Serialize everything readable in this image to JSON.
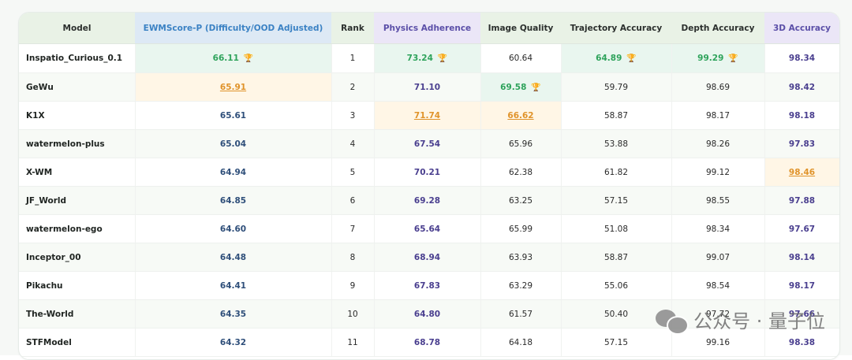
{
  "headers": {
    "model": "Model",
    "ewm": "EWMScore-P (Difficulty/OOD Adjusted)",
    "rank": "Rank",
    "phys": "Physics Adherence",
    "img": "Image Quality",
    "traj": "Trajectory Accuracy",
    "depth": "Depth Accuracy",
    "d3": "3D Accuracy"
  },
  "rows": [
    {
      "model": "Inspatio_Curious_0.1",
      "ewm": "66.11",
      "rank": "1",
      "phys": "73.24",
      "img": "60.64",
      "traj": "64.89",
      "depth": "99.29",
      "d3": "98.34"
    },
    {
      "model": "GeWu",
      "ewm": "65.91",
      "rank": "2",
      "phys": "71.10",
      "img": "69.58",
      "traj": "59.79",
      "depth": "98.69",
      "d3": "98.42"
    },
    {
      "model": "K1X",
      "ewm": "65.61",
      "rank": "3",
      "phys": "71.74",
      "img": "66.62",
      "traj": "58.87",
      "depth": "98.17",
      "d3": "98.18"
    },
    {
      "model": "watermelon-plus",
      "ewm": "65.04",
      "rank": "4",
      "phys": "67.54",
      "img": "65.96",
      "traj": "53.88",
      "depth": "98.26",
      "d3": "97.83"
    },
    {
      "model": "X-WM",
      "ewm": "64.94",
      "rank": "5",
      "phys": "70.21",
      "img": "62.38",
      "traj": "61.82",
      "depth": "99.12",
      "d3": "98.46"
    },
    {
      "model": "JF_World",
      "ewm": "64.85",
      "rank": "6",
      "phys": "69.28",
      "img": "63.25",
      "traj": "57.15",
      "depth": "98.55",
      "d3": "97.88"
    },
    {
      "model": "watermelon-ego",
      "ewm": "64.60",
      "rank": "7",
      "phys": "65.64",
      "img": "65.99",
      "traj": "51.08",
      "depth": "98.34",
      "d3": "97.67"
    },
    {
      "model": "Inceptor_00",
      "ewm": "64.48",
      "rank": "8",
      "phys": "68.94",
      "img": "63.93",
      "traj": "58.87",
      "depth": "99.07",
      "d3": "98.14"
    },
    {
      "model": "Pikachu",
      "ewm": "64.41",
      "rank": "9",
      "phys": "67.83",
      "img": "63.29",
      "traj": "55.06",
      "depth": "98.54",
      "d3": "98.17"
    },
    {
      "model": "The-World",
      "ewm": "64.35",
      "rank": "10",
      "phys": "64.80",
      "img": "61.57",
      "traj": "50.40",
      "depth": "97.72",
      "d3": "97.66"
    },
    {
      "model": "STFModel",
      "ewm": "64.32",
      "rank": "11",
      "phys": "68.78",
      "img": "64.18",
      "traj": "57.15",
      "depth": "99.16",
      "d3": "98.38"
    }
  ],
  "highlights": {
    "best_color": "#2ea35b",
    "second_color": "#e0932a",
    "trophy_icon": "trophy-icon"
  },
  "watermark": {
    "text": "公众号 · 量子位",
    "icon": "wechat-icon"
  }
}
